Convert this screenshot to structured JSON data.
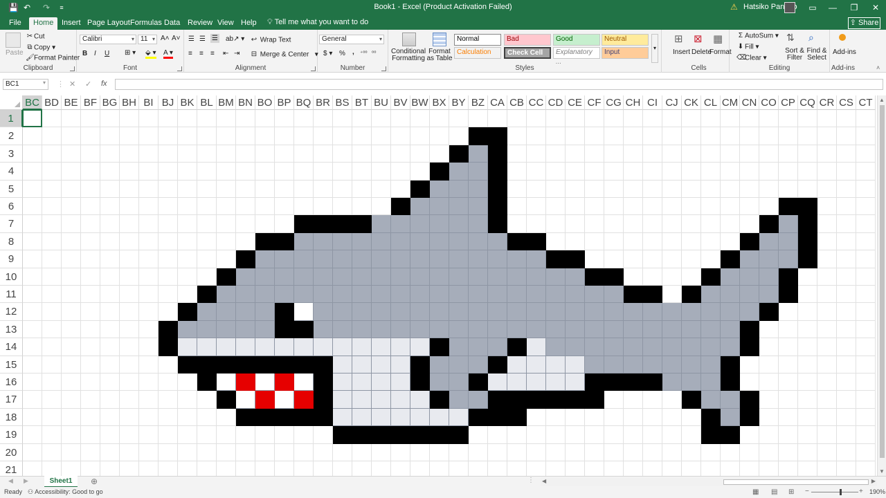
{
  "app": {
    "title": "Book1  -  Excel (Product Activation Failed)",
    "user": "Hatsiko Panado",
    "quick_access": [
      "💾",
      "↶",
      "↷",
      "≡"
    ],
    "window_buttons": [
      "▭",
      "—",
      "❐",
      "✕"
    ]
  },
  "tabs": {
    "file": "File",
    "items": [
      "Home",
      "Insert",
      "Page Layout",
      "Formulas",
      "Data",
      "Review",
      "View",
      "Help"
    ],
    "active": "Home",
    "tell_me": "Tell me what you want to do",
    "share": "Share"
  },
  "ribbon": {
    "clipboard": {
      "label": "Clipboard",
      "paste": "Paste",
      "cut": "Cut",
      "copy": "Copy",
      "format_painter": "Format Painter"
    },
    "font": {
      "label": "Font",
      "name": "Calibri",
      "size": "11",
      "bold": "B",
      "italic": "I",
      "underline": "U"
    },
    "alignment": {
      "label": "Alignment",
      "wrap": "Wrap Text",
      "merge": "Merge & Center"
    },
    "number": {
      "label": "Number",
      "format": "General",
      "currency": "$",
      "percent": "%",
      "comma": ","
    },
    "styles": {
      "label": "Styles",
      "conditional": "Conditional Formatting",
      "format_table": "Format as Table",
      "cells": [
        {
          "name": "Normal",
          "bg": "#ffffff",
          "fg": "#000000"
        },
        {
          "name": "Bad",
          "bg": "#ffc7ce",
          "fg": "#9c0006"
        },
        {
          "name": "Good",
          "bg": "#c6efce",
          "fg": "#006100"
        },
        {
          "name": "Neutral",
          "bg": "#ffeb9c",
          "fg": "#9c5700"
        },
        {
          "name": "Calculation",
          "bg": "#f2f2f2",
          "fg": "#fa7d00"
        },
        {
          "name": "Check Cell",
          "bg": "#a5a5a5",
          "fg": "#ffffff"
        },
        {
          "name": "Explanatory ...",
          "bg": "#ffffff",
          "fg": "#7f7f7f"
        },
        {
          "name": "Input",
          "bg": "#ffcc99",
          "fg": "#3f3f76"
        }
      ]
    },
    "cells": {
      "label": "Cells",
      "insert": "Insert",
      "delete": "Delete",
      "format": "Format"
    },
    "editing": {
      "label": "Editing",
      "autosum": "AutoSum",
      "fill": "Fill",
      "clear": "Clear",
      "sort": "Sort & Filter",
      "find": "Find & Select"
    },
    "addins": {
      "label": "Add-ins",
      "button": "Add-ins"
    }
  },
  "formula_bar": {
    "name_box": "BC1",
    "fx": "fx",
    "formula": ""
  },
  "grid": {
    "columns": [
      "BC",
      "BD",
      "BE",
      "BF",
      "BG",
      "BH",
      "BI",
      "BJ",
      "BK",
      "BL",
      "BM",
      "BN",
      "BO",
      "BP",
      "BQ",
      "BR",
      "BS",
      "BT",
      "BU",
      "BV",
      "BW",
      "BX",
      "BY",
      "BZ",
      "CA",
      "CB",
      "CC",
      "CD",
      "CE",
      "CF",
      "CG",
      "CH",
      "CI",
      "CJ",
      "CK",
      "CL",
      "CM",
      "CN",
      "CO",
      "CP",
      "CQ",
      "CR",
      "CS",
      "CT"
    ],
    "rows": [
      "1",
      "2",
      "3",
      "4",
      "5",
      "6",
      "7",
      "8",
      "9",
      "10",
      "11",
      "12",
      "13",
      "14",
      "15",
      "16",
      "17",
      "18",
      "19",
      "20",
      "21"
    ],
    "selected_cell": "BC1",
    "palette": {
      "K": "#000000",
      "G": "#a6adba",
      "L": "#e8eaef",
      "R": "#e60000",
      "W": "#ffffff"
    },
    "art": [
      "............................................",
      ".......................KK...................",
      "......................KGK...................",
      ".....................KGGK...................",
      "....................KGGGK...................",
      "...................KGGGGK..............KK...",
      "..............KKKKGGGGGGK.............KGK...",
      "............KKGGGGGGGGGGGKK..........KGGK...",
      "...........KGGGGGGGGGGGGGGGKK.......KGGGK...",
      "..........KGGGGGGGGGGGGGGGGGGKK....KGGGK....",
      ".........KGGGGGGGGGGGGGGGGGGGGGKK.KGGGGK....",
      "........KGGGGKWGGGGGGGGGGGGGGGGGGGGGGGK.....",
      ".......KGGGGGKKGGGGGGGGGGGGGGGGGGGGGGK......",
      ".......KLLLLLLLLLLLLLKGGGKLGGGGGGGGGGK......",
      "........KKKKKKKKLLLLKGGGKLLLLGGGGGGGK......",
      ".........KWRWRWKLLLLKGGKLLLLLKKKKGGGK.......",
      "..........KWRWRKLLLLLKGGKKKKKK....KGGK......",
      "...........KKKKKLLLLLLLKKK.........KGK......",
      "................KKKKKKK............KK.......",
      "............................................",
      "............................................"
    ]
  },
  "sheets": {
    "tabs": [
      "Sheet1"
    ],
    "active": "Sheet1"
  },
  "status": {
    "ready": "Ready",
    "accessibility": "Accessibility: Good to go",
    "zoom": "190%"
  }
}
